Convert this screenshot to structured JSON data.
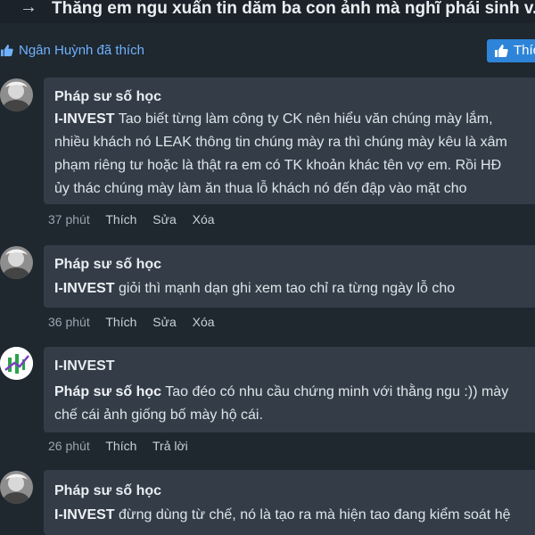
{
  "header": {
    "title": "Thằng em ngu xuẩn tin dăm ba con ảnh mà nghĩ phái sinh v..."
  },
  "likes": {
    "text": "Ngân Huỳnh đã thích",
    "button_label": "Thích"
  },
  "comments": [
    {
      "author": "Pháp sư số học",
      "mention": "I-INVEST",
      "text": " Tao biết từng làm công ty CK nên hiểu văn chúng mày lắm, nhiều khách nó LEAK thông tin chúng mày ra thì chúng mày kêu là xâm phạm riêng tư hoặc là thật ra em có TK khoản khác tên vợ em. Rồi HĐ ủy thác chúng mày làm ăn thua lỗ khách nó đến đập vào mặt cho",
      "time": "37 phút",
      "actions": [
        "Thích",
        "Sửa",
        "Xóa"
      ]
    },
    {
      "author": "Pháp sư số học",
      "mention": "I-INVEST",
      "text": " giỏi thì mạnh dạn ghi xem tao chỉ ra từng ngày lỗ cho",
      "time": "36 phút",
      "actions": [
        "Thích",
        "Sửa",
        "Xóa"
      ]
    },
    {
      "author": "I-INVEST",
      "mention": "Pháp sư số học",
      "text": " Tao đéo có nhu cầu chứng minh với thằng ngu :)) mày chế cái ảnh giống bố mày hộ cái.",
      "time": "26 phút",
      "actions": [
        "Thích",
        "Trả lời"
      ]
    },
    {
      "author": "Pháp sư số học",
      "mention": "I-INVEST",
      "text": " đừng dùng từ chế, nó là tạo ra mà hiện tao đang kiểm soát hệ",
      "time": "",
      "actions": []
    }
  ],
  "colors": {
    "background": "#1f272f",
    "bubble": "#343d47",
    "link": "#6fb2ff",
    "like_button": "#2e84d8"
  }
}
